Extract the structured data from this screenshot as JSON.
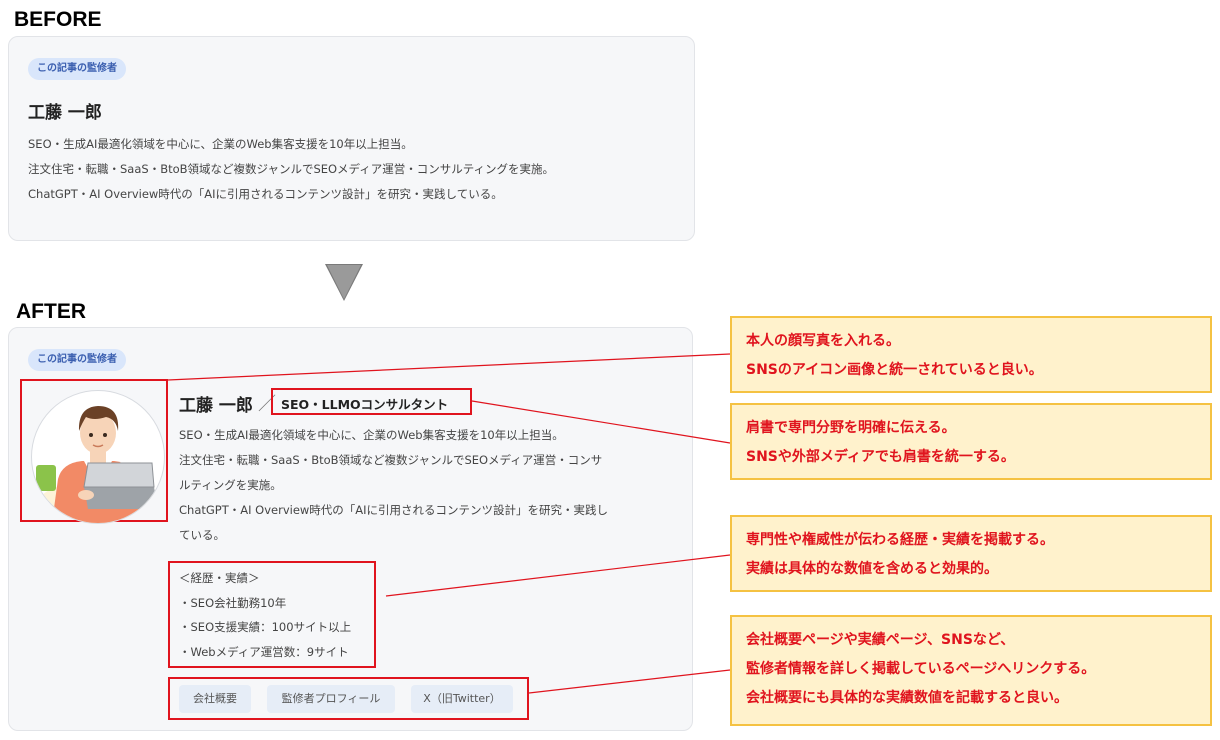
{
  "before": {
    "label": "BEFORE",
    "badge": "この記事の監修者",
    "name": "工藤 一郎",
    "desc_lines": [
      "SEO・生成AI最適化領域を中心に、企業のWeb集客支援を10年以上担当。",
      "注文住宅・転職・SaaS・BtoB領域など複数ジャンルでSEOメディア運営・コンサルティングを実施。",
      "ChatGPT・AI Overview時代の「AIに引用されるコンテンツ設計」を研究・実践している。"
    ]
  },
  "after": {
    "label": "AFTER",
    "badge": "この記事の監修者",
    "name": "工藤 一郎",
    "slash": "／",
    "title": "SEO・LLMOコンサルタント",
    "desc_lines": [
      "SEO・生成AI最適化領域を中心に、企業のWeb集客支援を10年以上担当。",
      "注文住宅・転職・SaaS・BtoB領域など複数ジャンルでSEOメディア運営・コンサ",
      "ルティングを実施。",
      "ChatGPT・AI Overview時代の「AIに引用されるコンテンツ設計」を研究・実践し",
      "ている。"
    ],
    "career_heading": "＜経歴・実績＞",
    "career_items": [
      "・SEO会社勤務10年",
      "・SEO支援実績：100サイト以上",
      "・Webメディア運営数：9サイト"
    ],
    "links": [
      "会社概要",
      "監修者プロフィール",
      "X（旧Twitter）"
    ]
  },
  "callouts": [
    {
      "lines": [
        "本人の顔写真を入れる。",
        "SNSのアイコン画像と統一されていると良い。"
      ]
    },
    {
      "lines": [
        "肩書で専門分野を明確に伝える。",
        "SNSや外部メディアでも肩書を統一する。"
      ]
    },
    {
      "lines": [
        "専門性や権威性が伝わる経歴・実績を掲載する。",
        "実績は具体的な数値を含めると効果的。"
      ]
    },
    {
      "lines": [
        "会社概要ページや実績ページ、SNSなど、",
        "監修者情報を詳しく掲載しているページへリンクする。",
        "会社概要にも具体的な実績数値を記載すると良い。"
      ]
    }
  ],
  "colors": {
    "accent_red": "#e0141e",
    "callout_bg": "#fff2cc",
    "callout_border": "#f5c242",
    "badge_bg": "#d9e6fb",
    "badge_text": "#3b5fb0"
  }
}
